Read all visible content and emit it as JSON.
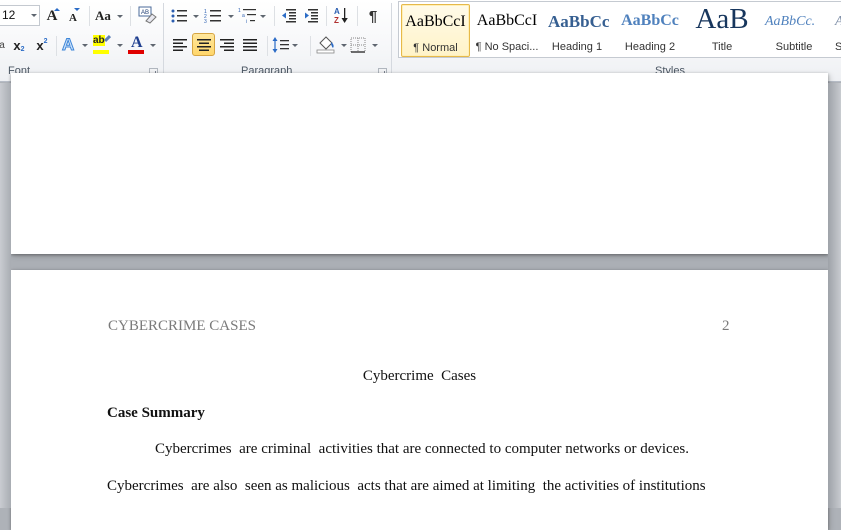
{
  "ribbon": {
    "font_group": {
      "label": "Font",
      "font_size": "12",
      "grow_font_label": "A",
      "shrink_font_label": "A",
      "change_case_label": "Aa",
      "clear_formatting_label": "AB",
      "subscript_label": "x",
      "subscript_sub": "2",
      "superscript_label": "x",
      "superscript_sup": "2",
      "text_effects_label": "A",
      "highlight_label": "ab",
      "font_color_label": "A",
      "highlight_color": "#ffff00",
      "font_color": "#e00000"
    },
    "paragraph_group": {
      "label": "Paragraph",
      "pilcrow": "¶",
      "sort_label": "A↓"
    },
    "styles_group": {
      "label": "Styles",
      "styles": [
        {
          "sample": "AaBbCcI",
          "name": "¶ Normal",
          "selected": true
        },
        {
          "sample": "AaBbCcI",
          "name": "¶ No Spaci...",
          "selected": false
        },
        {
          "sample": "AaBbCc",
          "name": "Heading 1",
          "selected": false
        },
        {
          "sample": "AaBbCc",
          "name": "Heading 2",
          "selected": false
        },
        {
          "sample": "AaB",
          "name": "Title",
          "selected": false
        },
        {
          "sample": "AaBbCc.",
          "name": "Subtitle",
          "selected": false
        },
        {
          "sample": "A",
          "name": "S",
          "selected": false
        }
      ]
    }
  },
  "document": {
    "page2": {
      "running_head": "CYBERCRIME CASES",
      "page_number": "2",
      "title": "Cybercrime  Cases",
      "section_heading": "Case Summary",
      "paragraph_lines": [
        "Cybercrimes  are criminal  activities that are connected to computer networks or devices.",
        "Cybercrimes  are also  seen as malicious  acts that are aimed at limiting  the activities of institutions"
      ]
    }
  }
}
